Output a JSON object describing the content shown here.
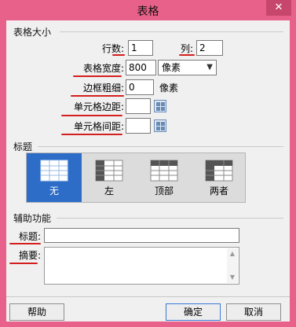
{
  "window": {
    "title": "表格",
    "close_glyph": "✕"
  },
  "size_group": {
    "title": "表格大小",
    "rows_label": "行数:",
    "rows_value": "1",
    "cols_label": "列:",
    "cols_value": "2",
    "width_label": "表格宽度:",
    "width_value": "800",
    "width_unit": "像素",
    "border_label": "边框粗细:",
    "border_value": "0",
    "border_unit": "像素",
    "padding_label": "单元格边距:",
    "padding_value": "",
    "spacing_label": "单元格间距:",
    "spacing_value": ""
  },
  "header_group": {
    "title": "标题",
    "options": [
      {
        "label": "无",
        "selected": true
      },
      {
        "label": "左",
        "selected": false
      },
      {
        "label": "顶部",
        "selected": false
      },
      {
        "label": "两者",
        "selected": false
      }
    ]
  },
  "accessibility_group": {
    "title": "辅助功能",
    "caption_label": "标题:",
    "caption_value": "",
    "summary_label": "摘要:",
    "summary_value": ""
  },
  "footer": {
    "help_label": "帮助",
    "ok_label": "确定",
    "cancel_label": "取消"
  },
  "colors": {
    "accent": "#e8618a",
    "selected_tab": "#2d6dc8",
    "annotation": "#d41f1f"
  }
}
